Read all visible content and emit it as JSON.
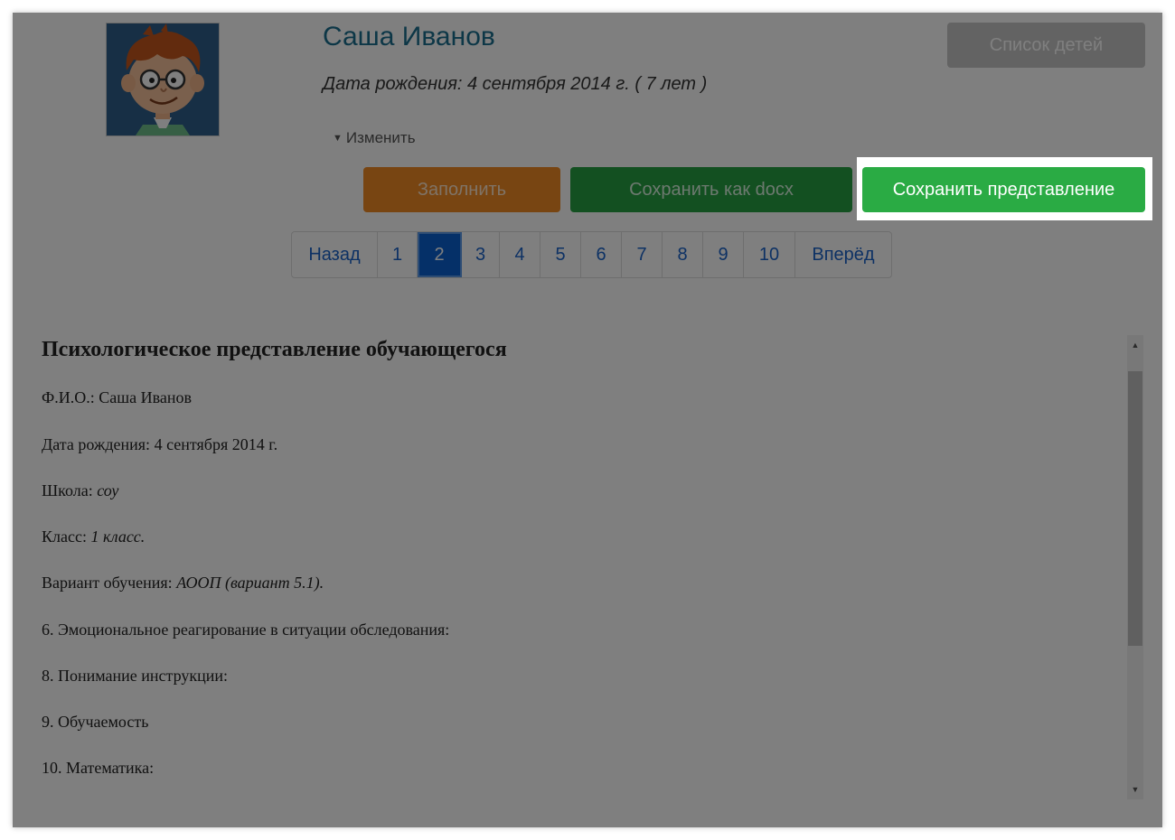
{
  "child": {
    "name": "Саша Иванов",
    "dob": "Дата рождения: 4 сентября 2014 г. ( 7 лет )",
    "edit_label": "Изменить"
  },
  "buttons": {
    "children_list": "Список детей",
    "fill": "Заполнить",
    "save_docx": "Сохранить как docx",
    "save_representation": "Сохранить представление"
  },
  "pagination": {
    "prev": "Назад",
    "pages": [
      "1",
      "2",
      "3",
      "4",
      "5",
      "6",
      "7",
      "8",
      "9",
      "10"
    ],
    "active_page": "2",
    "next": "Вперёд"
  },
  "document": {
    "title": "Психологическое представление обучающегося",
    "fio_label": "Ф.И.О.:",
    "fio_value": "Саша Иванов",
    "dob_label": "Дата рождения:",
    "dob_value": "4 сентября 2014 г.",
    "school_label": "Школа:",
    "school_value": "соу",
    "class_label": "Класс:",
    "class_value": "1 класс.",
    "variant_label": "Вариант обучения:",
    "variant_value": "АООП (вариант 5.1).",
    "item6": "6. Эмоциональное реагирование в ситуации обследования:",
    "item8": "8. Понимание инструкции:",
    "item9": "9. Обучаемость",
    "item10": "10. Математика:"
  },
  "colors": {
    "accent_orange": "#f08a24",
    "accent_green": "#2aab44",
    "link_blue": "#1a63c9",
    "active_page_blue": "#0a60d0"
  },
  "icons": {
    "avatar": "cartoon-boy-avatar",
    "edit_caret": "caret-down-icon",
    "scroll_up": "scroll-up-arrow-icon",
    "scroll_down": "scroll-down-arrow-icon"
  }
}
